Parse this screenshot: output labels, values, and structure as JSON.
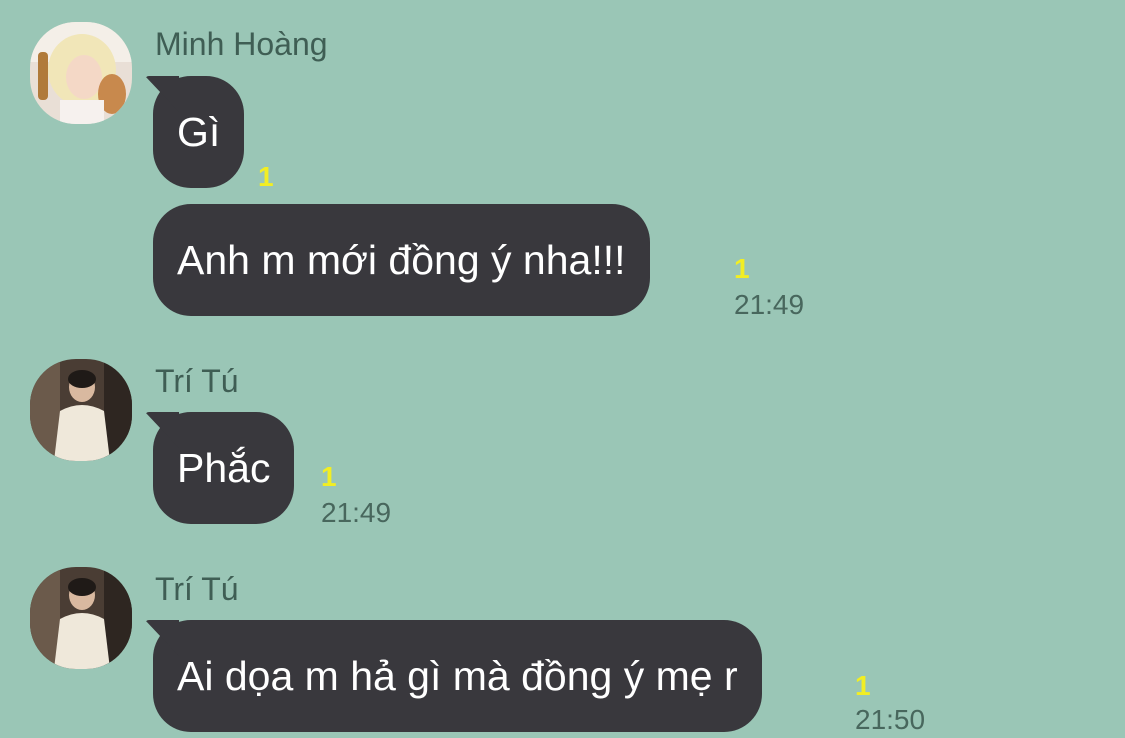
{
  "colors": {
    "background": "#9ac6b6",
    "bubble": "#39383d",
    "bubble_text": "#ffffff",
    "sender_text": "#3f5e54",
    "unread_badge": "#f2ee23",
    "timestamp": "#48675d"
  },
  "messages": [
    {
      "sender": "Minh Hoàng",
      "avatar_icon": "avatar-blonde-person-icon",
      "bubbles": [
        {
          "text": "Gì",
          "unread": "1",
          "time": ""
        },
        {
          "text": "Anh m mới đồng ý nha!!!",
          "unread": "1",
          "time": "21:49"
        }
      ]
    },
    {
      "sender": "Trí Tú",
      "avatar_icon": "avatar-person-white-sweater-icon",
      "bubbles": [
        {
          "text": "Phắc",
          "unread": "1",
          "time": "21:49"
        }
      ]
    },
    {
      "sender": "Trí Tú",
      "avatar_icon": "avatar-person-white-sweater-icon",
      "bubbles": [
        {
          "text": "Ai dọa m hả gì mà đồng ý mẹ r",
          "unread": "1",
          "time": "21:50"
        }
      ]
    }
  ]
}
